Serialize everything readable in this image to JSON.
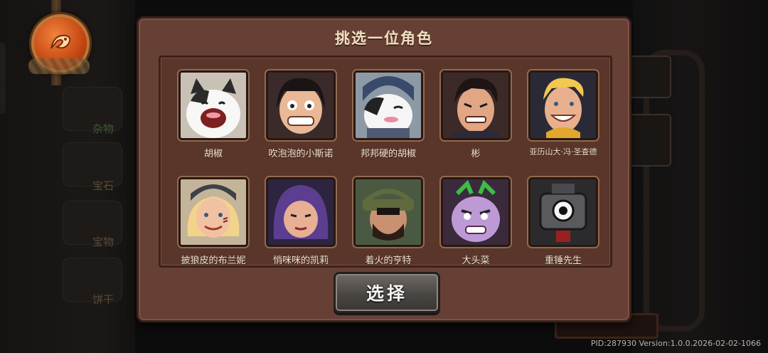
{
  "background": {
    "categories": [
      {
        "label": "杂物"
      },
      {
        "label": "宝石"
      },
      {
        "label": "宝物"
      },
      {
        "label": "饼干"
      }
    ]
  },
  "dialog": {
    "title": "挑选一位角色",
    "characters": [
      {
        "name": "胡椒",
        "icon": "white-cat-portrait"
      },
      {
        "name": "吹泡泡的小斯诺",
        "icon": "girl-bangs-portrait"
      },
      {
        "name": "邦邦硬的胡椒",
        "icon": "armored-cat-portrait"
      },
      {
        "name": "彬",
        "icon": "dark-hair-man-portrait"
      },
      {
        "name": "亚历山大·冯·圣查德",
        "icon": "blond-man-portrait"
      },
      {
        "name": "披狼皮的布兰妮",
        "icon": "blonde-girl-beanie-portrait"
      },
      {
        "name": "悄咪咪的凯莉",
        "icon": "purple-hair-girl-portrait"
      },
      {
        "name": "着火的亨特",
        "icon": "helmet-bearded-man-portrait"
      },
      {
        "name": "大头菜",
        "icon": "turnip-monster-portrait"
      },
      {
        "name": "重锤先生",
        "icon": "hammer-robot-portrait"
      }
    ],
    "select_label": "选择"
  },
  "footer": {
    "version_text": "PID:287930  Version:1.0.0.2026-02-02-1066"
  },
  "colors": {
    "dialog_bg": "#664035",
    "roster_bg": "#5a3529",
    "title_text": "#f1dfc2",
    "button_bg": "#4a4643"
  }
}
